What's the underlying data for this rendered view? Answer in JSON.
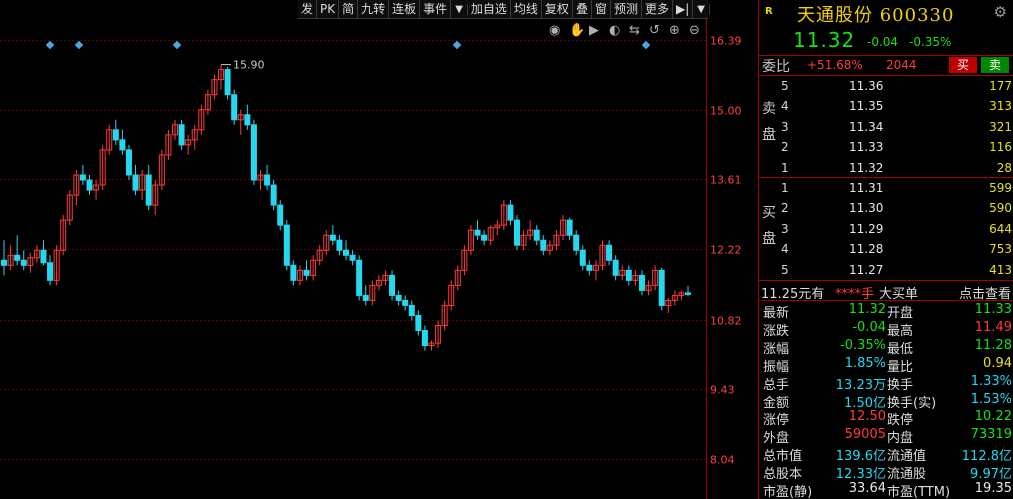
{
  "toolbar": {
    "items": [
      "发",
      "PK",
      "简",
      "九转",
      "连板",
      "事件",
      "▼",
      "加自选",
      "均线",
      "复权",
      "叠",
      "窗",
      "预测",
      "更多",
      "▶|",
      "▼"
    ]
  },
  "chart_data": {
    "type": "candlestick",
    "y_ticks": [
      "16.39",
      "15.00",
      "13.61",
      "12.22",
      "10.82",
      "9.43",
      "8.04"
    ],
    "ylim": [
      8.04,
      16.39
    ],
    "annotation_high": "15.90",
    "colors": {
      "up": "#ff3b3b",
      "down": "#24d8f0",
      "grid": "#5a0000",
      "axis": "#a00000",
      "tick": "#ff4040"
    },
    "candles": [
      {
        "o": 12.0,
        "h": 12.4,
        "l": 11.7,
        "c": 11.9
      },
      {
        "o": 11.9,
        "h": 12.3,
        "l": 11.8,
        "c": 12.1
      },
      {
        "o": 12.1,
        "h": 12.5,
        "l": 11.9,
        "c": 12.0
      },
      {
        "o": 12.0,
        "h": 12.2,
        "l": 11.8,
        "c": 11.9
      },
      {
        "o": 11.9,
        "h": 12.15,
        "l": 11.75,
        "c": 12.05
      },
      {
        "o": 12.05,
        "h": 12.3,
        "l": 11.95,
        "c": 12.2
      },
      {
        "o": 12.2,
        "h": 12.4,
        "l": 11.9,
        "c": 11.95
      },
      {
        "o": 11.95,
        "h": 12.1,
        "l": 11.5,
        "c": 11.6
      },
      {
        "o": 11.6,
        "h": 12.3,
        "l": 11.5,
        "c": 12.2
      },
      {
        "o": 12.2,
        "h": 12.9,
        "l": 12.1,
        "c": 12.8
      },
      {
        "o": 12.8,
        "h": 13.4,
        "l": 12.7,
        "c": 13.3
      },
      {
        "o": 13.3,
        "h": 13.8,
        "l": 13.1,
        "c": 13.7
      },
      {
        "o": 13.7,
        "h": 13.9,
        "l": 13.5,
        "c": 13.6
      },
      {
        "o": 13.6,
        "h": 13.7,
        "l": 13.3,
        "c": 13.4
      },
      {
        "o": 13.4,
        "h": 13.6,
        "l": 13.2,
        "c": 13.5
      },
      {
        "o": 13.5,
        "h": 14.3,
        "l": 13.4,
        "c": 14.2
      },
      {
        "o": 14.2,
        "h": 14.7,
        "l": 14.1,
        "c": 14.6
      },
      {
        "o": 14.6,
        "h": 14.8,
        "l": 14.3,
        "c": 14.4
      },
      {
        "o": 14.4,
        "h": 14.6,
        "l": 14.1,
        "c": 14.2
      },
      {
        "o": 14.2,
        "h": 14.3,
        "l": 13.6,
        "c": 13.7
      },
      {
        "o": 13.7,
        "h": 13.9,
        "l": 13.3,
        "c": 13.4
      },
      {
        "o": 13.4,
        "h": 13.8,
        "l": 13.2,
        "c": 13.7
      },
      {
        "o": 13.7,
        "h": 13.9,
        "l": 13.0,
        "c": 13.1
      },
      {
        "o": 13.1,
        "h": 13.6,
        "l": 12.9,
        "c": 13.5
      },
      {
        "o": 13.5,
        "h": 14.2,
        "l": 13.4,
        "c": 14.1
      },
      {
        "o": 14.1,
        "h": 14.6,
        "l": 14.0,
        "c": 14.5
      },
      {
        "o": 14.5,
        "h": 14.8,
        "l": 14.4,
        "c": 14.7
      },
      {
        "o": 14.7,
        "h": 14.8,
        "l": 14.2,
        "c": 14.3
      },
      {
        "o": 14.3,
        "h": 14.5,
        "l": 14.1,
        "c": 14.4
      },
      {
        "o": 14.4,
        "h": 14.7,
        "l": 14.2,
        "c": 14.6
      },
      {
        "o": 14.6,
        "h": 15.1,
        "l": 14.5,
        "c": 15.0
      },
      {
        "o": 15.0,
        "h": 15.4,
        "l": 14.9,
        "c": 15.3
      },
      {
        "o": 15.3,
        "h": 15.7,
        "l": 15.2,
        "c": 15.6
      },
      {
        "o": 15.6,
        "h": 15.9,
        "l": 15.4,
        "c": 15.8
      },
      {
        "o": 15.8,
        "h": 15.85,
        "l": 15.2,
        "c": 15.3
      },
      {
        "o": 15.3,
        "h": 15.4,
        "l": 14.7,
        "c": 14.8
      },
      {
        "o": 14.8,
        "h": 15.0,
        "l": 14.5,
        "c": 14.9
      },
      {
        "o": 14.9,
        "h": 15.1,
        "l": 14.6,
        "c": 14.7
      },
      {
        "o": 14.7,
        "h": 14.8,
        "l": 13.5,
        "c": 13.6
      },
      {
        "o": 13.6,
        "h": 13.8,
        "l": 13.4,
        "c": 13.7
      },
      {
        "o": 13.7,
        "h": 13.9,
        "l": 13.4,
        "c": 13.5
      },
      {
        "o": 13.5,
        "h": 13.6,
        "l": 13.0,
        "c": 13.1
      },
      {
        "o": 13.1,
        "h": 13.2,
        "l": 12.6,
        "c": 12.7
      },
      {
        "o": 12.7,
        "h": 12.8,
        "l": 11.8,
        "c": 11.9
      },
      {
        "o": 11.9,
        "h": 12.0,
        "l": 11.5,
        "c": 11.6
      },
      {
        "o": 11.6,
        "h": 11.9,
        "l": 11.5,
        "c": 11.8
      },
      {
        "o": 11.8,
        "h": 12.0,
        "l": 11.6,
        "c": 11.7
      },
      {
        "o": 11.7,
        "h": 12.1,
        "l": 11.6,
        "c": 12.0
      },
      {
        "o": 12.0,
        "h": 12.3,
        "l": 11.9,
        "c": 12.2
      },
      {
        "o": 12.2,
        "h": 12.6,
        "l": 12.1,
        "c": 12.5
      },
      {
        "o": 12.5,
        "h": 12.7,
        "l": 12.3,
        "c": 12.4
      },
      {
        "o": 12.4,
        "h": 12.5,
        "l": 12.1,
        "c": 12.2
      },
      {
        "o": 12.2,
        "h": 12.4,
        "l": 12.0,
        "c": 12.1
      },
      {
        "o": 12.1,
        "h": 12.2,
        "l": 11.9,
        "c": 12.0
      },
      {
        "o": 12.0,
        "h": 12.1,
        "l": 11.2,
        "c": 11.3
      },
      {
        "o": 11.3,
        "h": 11.5,
        "l": 11.1,
        "c": 11.2
      },
      {
        "o": 11.2,
        "h": 11.6,
        "l": 11.1,
        "c": 11.5
      },
      {
        "o": 11.5,
        "h": 11.7,
        "l": 11.4,
        "c": 11.6
      },
      {
        "o": 11.6,
        "h": 11.8,
        "l": 11.5,
        "c": 11.7
      },
      {
        "o": 11.7,
        "h": 11.8,
        "l": 11.2,
        "c": 11.3
      },
      {
        "o": 11.3,
        "h": 11.4,
        "l": 11.1,
        "c": 11.2
      },
      {
        "o": 11.2,
        "h": 11.3,
        "l": 11.0,
        "c": 11.1
      },
      {
        "o": 11.1,
        "h": 11.2,
        "l": 10.8,
        "c": 10.9
      },
      {
        "o": 10.9,
        "h": 11.0,
        "l": 10.5,
        "c": 10.6
      },
      {
        "o": 10.6,
        "h": 10.7,
        "l": 10.2,
        "c": 10.3
      },
      {
        "o": 10.3,
        "h": 10.4,
        "l": 10.2,
        "c": 10.35
      },
      {
        "o": 10.35,
        "h": 10.8,
        "l": 10.25,
        "c": 10.7
      },
      {
        "o": 10.7,
        "h": 11.2,
        "l": 10.6,
        "c": 11.1
      },
      {
        "o": 11.1,
        "h": 11.6,
        "l": 11.0,
        "c": 11.5
      },
      {
        "o": 11.5,
        "h": 11.9,
        "l": 11.4,
        "c": 11.8
      },
      {
        "o": 11.8,
        "h": 12.3,
        "l": 11.7,
        "c": 12.2
      },
      {
        "o": 12.2,
        "h": 12.7,
        "l": 12.1,
        "c": 12.6
      },
      {
        "o": 12.6,
        "h": 12.8,
        "l": 12.4,
        "c": 12.5
      },
      {
        "o": 12.5,
        "h": 12.6,
        "l": 12.3,
        "c": 12.4
      },
      {
        "o": 12.4,
        "h": 12.7,
        "l": 12.3,
        "c": 12.65
      },
      {
        "o": 12.65,
        "h": 12.8,
        "l": 12.5,
        "c": 12.7
      },
      {
        "o": 12.7,
        "h": 13.2,
        "l": 12.6,
        "c": 13.1
      },
      {
        "o": 13.1,
        "h": 13.2,
        "l": 12.7,
        "c": 12.8
      },
      {
        "o": 12.8,
        "h": 12.9,
        "l": 12.2,
        "c": 12.3
      },
      {
        "o": 12.3,
        "h": 12.6,
        "l": 12.2,
        "c": 12.5
      },
      {
        "o": 12.5,
        "h": 12.8,
        "l": 12.4,
        "c": 12.6
      },
      {
        "o": 12.6,
        "h": 12.7,
        "l": 12.3,
        "c": 12.4
      },
      {
        "o": 12.4,
        "h": 12.5,
        "l": 12.1,
        "c": 12.2
      },
      {
        "o": 12.2,
        "h": 12.4,
        "l": 12.1,
        "c": 12.3
      },
      {
        "o": 12.3,
        "h": 12.6,
        "l": 12.2,
        "c": 12.5
      },
      {
        "o": 12.5,
        "h": 12.9,
        "l": 12.4,
        "c": 12.8
      },
      {
        "o": 12.8,
        "h": 12.85,
        "l": 12.4,
        "c": 12.5
      },
      {
        "o": 12.5,
        "h": 12.6,
        "l": 12.1,
        "c": 12.2
      },
      {
        "o": 12.2,
        "h": 12.3,
        "l": 11.8,
        "c": 11.9
      },
      {
        "o": 11.9,
        "h": 12.0,
        "l": 11.7,
        "c": 11.8
      },
      {
        "o": 11.8,
        "h": 12.0,
        "l": 11.6,
        "c": 11.9
      },
      {
        "o": 11.9,
        "h": 12.4,
        "l": 11.8,
        "c": 12.3
      },
      {
        "o": 12.3,
        "h": 12.4,
        "l": 11.9,
        "c": 12.0
      },
      {
        "o": 12.0,
        "h": 12.1,
        "l": 11.6,
        "c": 11.7
      },
      {
        "o": 11.7,
        "h": 11.9,
        "l": 11.6,
        "c": 11.8
      },
      {
        "o": 11.8,
        "h": 11.9,
        "l": 11.5,
        "c": 11.6
      },
      {
        "o": 11.6,
        "h": 11.8,
        "l": 11.5,
        "c": 11.7
      },
      {
        "o": 11.7,
        "h": 11.8,
        "l": 11.3,
        "c": 11.4
      },
      {
        "o": 11.4,
        "h": 11.6,
        "l": 11.3,
        "c": 11.5
      },
      {
        "o": 11.5,
        "h": 11.9,
        "l": 11.4,
        "c": 11.8
      },
      {
        "o": 11.8,
        "h": 11.85,
        "l": 11.0,
        "c": 11.1
      },
      {
        "o": 11.1,
        "h": 11.25,
        "l": 10.95,
        "c": 11.2
      },
      {
        "o": 11.2,
        "h": 11.4,
        "l": 11.1,
        "c": 11.3
      },
      {
        "o": 11.3,
        "h": 11.4,
        "l": 11.2,
        "c": 11.35
      },
      {
        "o": 11.35,
        "h": 11.49,
        "l": 11.28,
        "c": 11.32
      }
    ]
  },
  "panel": {
    "r_mark": "R",
    "stock_name": "天通股份",
    "stock_code": "600330",
    "price": "11.32",
    "change": "-0.04",
    "change_pct": "-0.35%",
    "wb_label": "委比",
    "wb_pct": "+51.68%",
    "wb_diff": "2044",
    "buy_btn": "买",
    "sell_btn": "卖",
    "sell_label": [
      "卖",
      "盘"
    ],
    "buy_label": [
      "买",
      "盘"
    ],
    "asks": [
      {
        "level": "5",
        "price": "11.36",
        "vol": "177"
      },
      {
        "level": "4",
        "price": "11.35",
        "vol": "313"
      },
      {
        "level": "3",
        "price": "11.34",
        "vol": "321"
      },
      {
        "level": "2",
        "price": "11.33",
        "vol": "116"
      },
      {
        "level": "1",
        "price": "11.32",
        "vol": "28"
      }
    ],
    "bids": [
      {
        "level": "1",
        "price": "11.31",
        "vol": "599"
      },
      {
        "level": "2",
        "price": "11.30",
        "vol": "590"
      },
      {
        "level": "3",
        "price": "11.29",
        "vol": "644"
      },
      {
        "level": "4",
        "price": "11.28",
        "vol": "753"
      },
      {
        "level": "5",
        "price": "11.27",
        "vol": "413"
      }
    ],
    "big_order": {
      "a": "11.25元有",
      "b": "****手",
      "c": "大买单",
      "d": "点击查看"
    },
    "stats": [
      {
        "l1": "最新",
        "v1": "11.32",
        "c1": "green",
        "l2": "开盘",
        "v2": "11.33",
        "c2": "green"
      },
      {
        "l1": "涨跌",
        "v1": "-0.04",
        "c1": "green",
        "l2": "最高",
        "v2": "11.49",
        "c2": "red"
      },
      {
        "l1": "涨幅",
        "v1": "-0.35%",
        "c1": "green",
        "l2": "最低",
        "v2": "11.28",
        "c2": "green"
      },
      {
        "l1": "振幅",
        "v1": "1.85%",
        "c1": "cyan",
        "l2": "量比",
        "v2": "0.94",
        "c2": "yellow"
      },
      {
        "l1": "总手",
        "v1": "13.23万",
        "c1": "cyan",
        "l2": "换手",
        "v2": "1.33%",
        "c2": "cyan"
      },
      {
        "l1": "金额",
        "v1": "1.50亿",
        "c1": "cyan",
        "l2": "换手(实)",
        "v2": "1.53%",
        "c2": "cyan"
      },
      {
        "l1": "涨停",
        "v1": "12.50",
        "c1": "red",
        "l2": "跌停",
        "v2": "10.22",
        "c2": "green"
      },
      {
        "l1": "外盘",
        "v1": "59005",
        "c1": "red",
        "l2": "内盘",
        "v2": "73319",
        "c2": "green"
      },
      {
        "l1": "总市值",
        "v1": "139.6亿",
        "c1": "cyan",
        "l2": "流通值",
        "v2": "112.8亿",
        "c2": "cyan"
      },
      {
        "l1": "总股本",
        "v1": "12.33亿",
        "c1": "cyan",
        "l2": "流通股",
        "v2": "9.97亿",
        "c2": "cyan"
      },
      {
        "l1": "市盈(静)",
        "v1": "33.64",
        "c1": "white",
        "l2": "市盈(TTM)",
        "v2": "19.35",
        "c2": "white"
      }
    ]
  }
}
